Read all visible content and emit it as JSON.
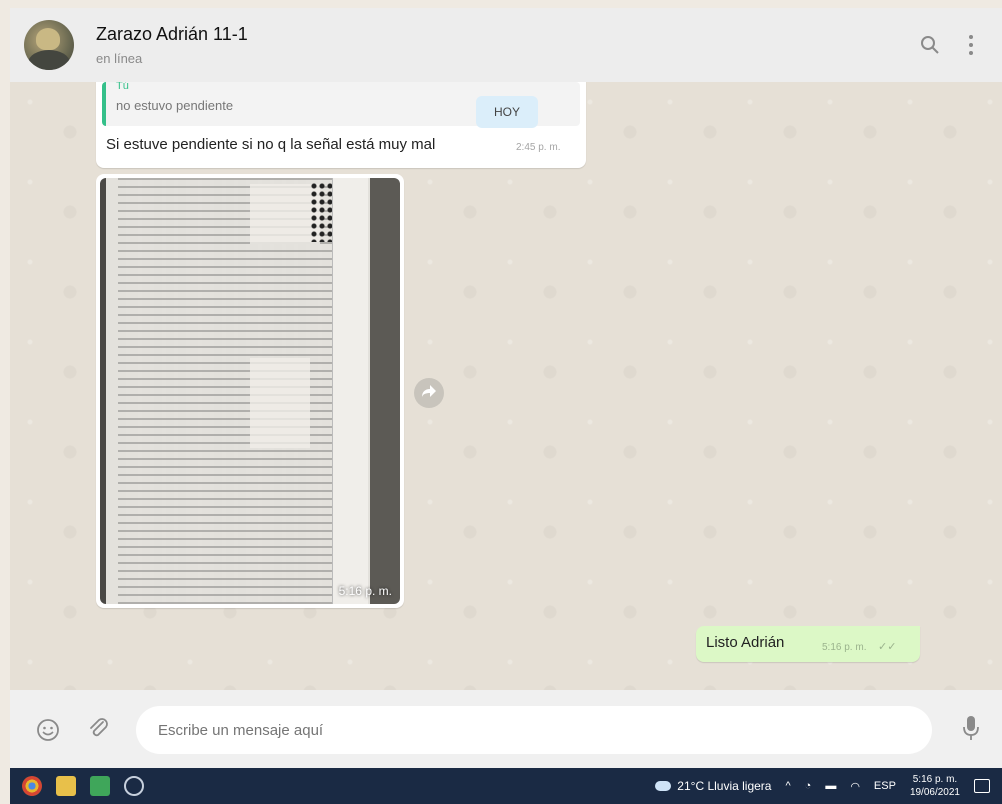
{
  "header": {
    "contact_name": "Zarazo Adrián 11-1",
    "contact_status": "en línea",
    "icons": [
      "search-icon",
      "menu-icon"
    ]
  },
  "chat": {
    "date_chip": "HOY",
    "incoming": {
      "quote_author": "Tú",
      "quote_text": "no estuvo pendiente",
      "text": "Si estuve pendiente si no q la señal está muy mal",
      "time": "2:45 p. m."
    },
    "image_message": {
      "time": "5:16 p. m."
    },
    "outgoing": {
      "text": "Listo Adrián",
      "time": "5:16 p. m.",
      "status": "read"
    }
  },
  "composer": {
    "placeholder": "Escribe un mensaje aquí",
    "icons": [
      "emoji-icon",
      "attach-icon",
      "microphone-icon"
    ]
  },
  "taskbar": {
    "weather": "21°C Lluvia ligera",
    "language": "ESP",
    "time": "5:16 p. m.",
    "date": "19/06/2021"
  },
  "colors": {
    "outgoing_bubble": "#dcf8c6",
    "quote_accent": "#35c08a",
    "taskbar": "#1a2a44"
  }
}
